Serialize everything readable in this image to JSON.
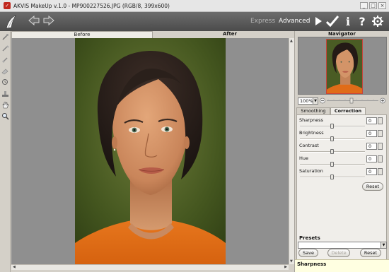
{
  "window": {
    "title": "AKVIS MakeUp v.1.0 - MP900227526.JPG (RGB/8, 399x600)",
    "controls": [
      "_",
      "□",
      "×"
    ]
  },
  "toolbar": {
    "mode_express": "Express",
    "mode_advanced": "Advanced",
    "icons": [
      "akvis-logo-icon",
      "undo-arrow-icon",
      "redo-arrow-icon",
      "run-icon",
      "apply-icon",
      "info-icon",
      "help-icon",
      "settings-icon"
    ]
  },
  "tools": [
    "wand-icon",
    "brush-icon",
    "brush-2-icon",
    "eraser-icon",
    "history-brush-icon",
    "stamp-icon",
    "hand-icon",
    "zoom-icon"
  ],
  "view_tabs": {
    "before": "Before",
    "after": "After",
    "active": "After"
  },
  "navigator": {
    "title": "Navigator",
    "zoom": "100%"
  },
  "settings_tabs": {
    "smoothing": "Smoothing",
    "correction": "Correction",
    "active": "Correction"
  },
  "params": [
    {
      "label": "Sharpness",
      "value": "0",
      "level": 0.5
    },
    {
      "label": "Brightness",
      "value": "0",
      "level": 0.5
    },
    {
      "label": "Contrast",
      "value": "0",
      "level": 0.5
    },
    {
      "label": "Hue",
      "value": "0",
      "level": 0.5
    },
    {
      "label": "Saturation",
      "value": "0",
      "level": 0.5
    }
  ],
  "buttons": {
    "reset": "Reset",
    "save": "Save",
    "delete": "Delete",
    "presets_reset": "Reset"
  },
  "presets": {
    "title": "Presets",
    "selected": ""
  },
  "hint": {
    "text": "Sharpness"
  },
  "colors": {
    "toolbar": "#555555",
    "canvas_bg": "#8f8f8f",
    "panel_bg": "#d4d0c8",
    "hint_bg": "#ffffe1",
    "accent_red": "#c0281e"
  }
}
